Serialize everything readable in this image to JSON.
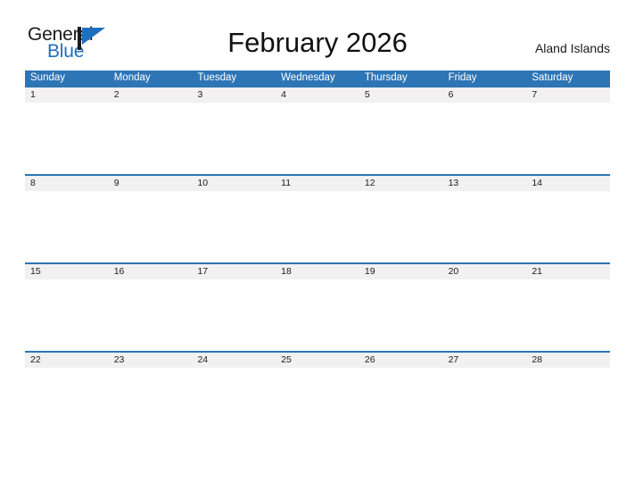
{
  "brand": {
    "name_part1": "General",
    "name_part2": "Blue",
    "flag_icon": "blue-flag-triangle-icon",
    "dark_color": "#1a1a1a",
    "blue_color": "#1f6fc0"
  },
  "header": {
    "title": "February 2026",
    "month": "February",
    "year": "2026",
    "region": "Aland Islands"
  },
  "theme": {
    "header_blue": "#2e75b6",
    "date_strip_gray": "#f1f1f1",
    "page_background": "#ffffff",
    "text_color": "#1a1a1a"
  },
  "calendar": {
    "weekdays": [
      "Sunday",
      "Monday",
      "Tuesday",
      "Wednesday",
      "Thursday",
      "Friday",
      "Saturday"
    ],
    "weeks": [
      {
        "days": [
          {
            "number": "1"
          },
          {
            "number": "2"
          },
          {
            "number": "3"
          },
          {
            "number": "4"
          },
          {
            "number": "5"
          },
          {
            "number": "6"
          },
          {
            "number": "7"
          }
        ]
      },
      {
        "days": [
          {
            "number": "8"
          },
          {
            "number": "9"
          },
          {
            "number": "10"
          },
          {
            "number": "11"
          },
          {
            "number": "12"
          },
          {
            "number": "13"
          },
          {
            "number": "14"
          }
        ]
      },
      {
        "days": [
          {
            "number": "15"
          },
          {
            "number": "16"
          },
          {
            "number": "17"
          },
          {
            "number": "18"
          },
          {
            "number": "19"
          },
          {
            "number": "20"
          },
          {
            "number": "21"
          }
        ]
      },
      {
        "days": [
          {
            "number": "22"
          },
          {
            "number": "23"
          },
          {
            "number": "24"
          },
          {
            "number": "25"
          },
          {
            "number": "26"
          },
          {
            "number": "27"
          },
          {
            "number": "28"
          }
        ]
      }
    ]
  }
}
